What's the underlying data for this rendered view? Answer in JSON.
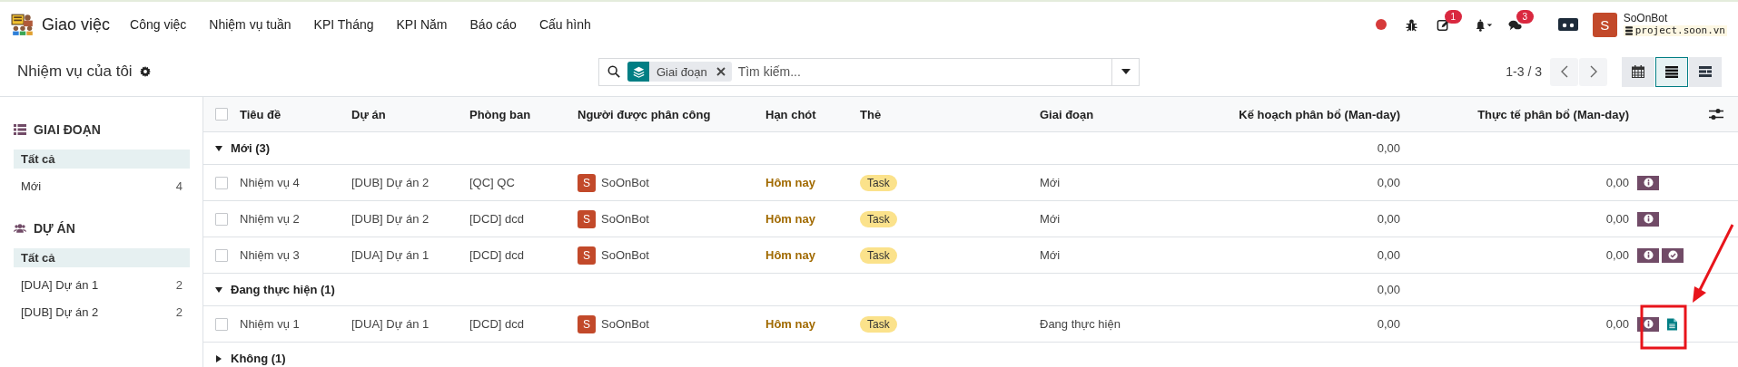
{
  "app": {
    "name": "Giao việc",
    "menu": [
      "Công việc",
      "Nhiệm vụ tuần",
      "KPI Tháng",
      "KPI Năm",
      "Báo cáo",
      "Cấu hình"
    ]
  },
  "systray": {
    "activity_count": "1",
    "message_count": "3",
    "user": {
      "initial": "S",
      "name": "SoOnBot",
      "database": "project.soon.vn"
    }
  },
  "breadcrumb": "Nhiệm vụ của tôi",
  "search": {
    "facet": "Giai đoạn",
    "placeholder": "Tìm kiếm..."
  },
  "pager": "1-3 / 3",
  "views": [
    {
      "kind": "calendar",
      "selected": false
    },
    {
      "kind": "list",
      "selected": true
    },
    {
      "kind": "gantt",
      "selected": false
    }
  ],
  "sidebar": [
    {
      "kind": "stage",
      "title": "GIAI ĐOẠN",
      "items": [
        {
          "label": "Tất cả",
          "selected": true
        },
        {
          "label": "Mới",
          "count": "4",
          "selected": false
        }
      ]
    },
    {
      "kind": "project",
      "title": "DỰ ÁN",
      "items": [
        {
          "label": "Tất cả",
          "selected": true
        },
        {
          "label": "[DUA] Dự án 1",
          "count": "2",
          "selected": false
        },
        {
          "label": "[DUB] Dự án 2",
          "count": "2",
          "selected": false
        }
      ]
    }
  ],
  "table": {
    "select_all_checked": false,
    "columns": [
      "Tiêu đề",
      "Dự án",
      "Phòng ban",
      "Người được phân công",
      "Hạn chót",
      "Thẻ",
      "Giai đoạn",
      "Kế hoạch phân bổ (Man-day)",
      "Thực tế phân bổ (Man-day)"
    ],
    "groups": [
      {
        "label": "Mới (3)",
        "expanded": true,
        "plan_total": "0,00",
        "rows": [
          {
            "checked": false,
            "title": "Nhiệm vụ 4",
            "project": "[DUB] Dự án 2",
            "department": "[QC] QC",
            "assignee": {
              "initial": "S",
              "name": "SoOnBot"
            },
            "deadline": "Hôm nay",
            "tag": "Task",
            "stage": "Mới",
            "plan": "0,00",
            "actual": "0,00",
            "actions": [
              {
                "kind": "info"
              }
            ]
          },
          {
            "checked": false,
            "title": "Nhiệm vụ 2",
            "project": "[DUB] Dự án 2",
            "department": "[DCD] dcd",
            "assignee": {
              "initial": "S",
              "name": "SoOnBot"
            },
            "deadline": "Hôm nay",
            "tag": "Task",
            "stage": "Mới",
            "plan": "0,00",
            "actual": "0,00",
            "actions": [
              {
                "kind": "info"
              }
            ]
          },
          {
            "checked": false,
            "title": "Nhiệm vụ 3",
            "project": "[DUA] Dự án 1",
            "department": "[DCD] dcd",
            "assignee": {
              "initial": "S",
              "name": "SoOnBot"
            },
            "deadline": "Hôm nay",
            "tag": "Task",
            "stage": "Mới",
            "plan": "0,00",
            "actual": "0,00",
            "actions": [
              {
                "kind": "info"
              },
              {
                "kind": "approve"
              }
            ]
          }
        ]
      },
      {
        "label": "Đang thực hiện (1)",
        "expanded": true,
        "plan_total": "0,00",
        "rows": [
          {
            "checked": false,
            "title": "Nhiệm vụ 1",
            "project": "[DUA] Dự án 1",
            "department": "[DCD] dcd",
            "assignee": {
              "initial": "S",
              "name": "SoOnBot"
            },
            "deadline": "Hôm nay",
            "tag": "Task",
            "stage": "Đang thực hiện",
            "plan": "0,00",
            "actual": "0,00",
            "actions": [
              {
                "kind": "info"
              },
              {
                "kind": "document"
              }
            ]
          }
        ]
      },
      {
        "label": "Không (1)",
        "expanded": false
      }
    ]
  }
}
